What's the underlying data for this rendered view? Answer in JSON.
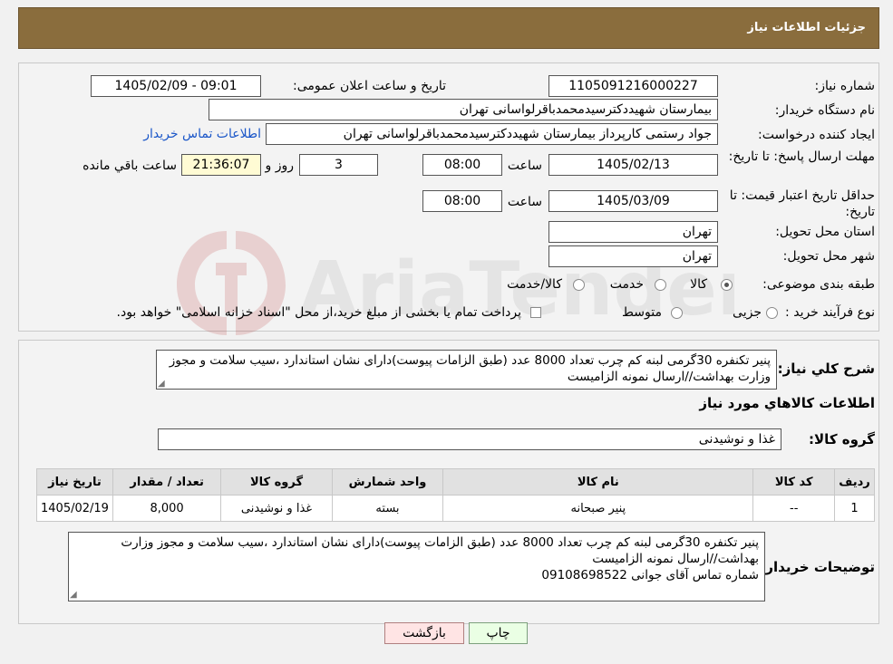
{
  "header": {
    "title": "جزئیات اطلاعات نیاز"
  },
  "form": {
    "need_number": {
      "label": "شماره نیاز:",
      "value": "1105091216000227"
    },
    "announce_datetime": {
      "label": "تاریخ و ساعت اعلان عمومی:",
      "value": "1405/02/09 - 09:01"
    },
    "buyer_org": {
      "label": "نام دستگاه خریدار:",
      "value": "بیمارستان شهیددکترسیدمحمدباقرلواسانی تهران"
    },
    "requester": {
      "label": "ایجاد کننده درخواست:",
      "value": "جواد رستمی کارپرداز بیمارستان شهیددکترسیدمحمدباقرلواسانی تهران",
      "contact_link": "اطلاعات تماس خریدار"
    },
    "deadline": {
      "label": "مهلت ارسال پاسخ: تا تاریخ:",
      "date": "1405/02/13",
      "time_label": "ساعت",
      "time": "08:00",
      "days": "3",
      "days_label": "روز و",
      "remaining": "21:36:07",
      "remaining_label": "ساعت باقي مانده"
    },
    "min_validity": {
      "label": "حداقل تاریخ اعتبار قیمت: تا تاریخ:",
      "date": "1405/03/09",
      "time_label": "ساعت",
      "time": "08:00"
    },
    "delivery_province": {
      "label": "استان محل تحویل:",
      "value": "تهران"
    },
    "delivery_city": {
      "label": "شهر محل تحویل:",
      "value": "تهران"
    },
    "category": {
      "label": "طبقه بندی موضوعی:",
      "options": [
        "کالا",
        "خدمت",
        "کالا/خدمت"
      ],
      "selected": "کالا"
    },
    "purchase_process": {
      "label": "نوع فرآیند خرید :",
      "options": [
        "جزیی",
        "متوسط"
      ],
      "note": "پرداخت تمام یا بخشی از مبلغ خرید،از محل \"اسناد خزانه اسلامی\" خواهد بود."
    }
  },
  "summary": {
    "label": "شرح کلي نياز:",
    "text": "پنیر تکنفره 30گرمی لبنه کم چرب تعداد 8000 عدد (طبق الزامات پیوست)دارای نشان استاندارد ،سیب سلامت و مجوز وزارت بهداشت//ارسال نمونه الزامیست"
  },
  "goods_section": {
    "title": "اطلاعات کالاهاي مورد نياز",
    "group_label": "گروه کالا:",
    "group_value": "غذا و نوشیدنی"
  },
  "items_table": {
    "headers": [
      "رديف",
      "کد کالا",
      "نام کالا",
      "واحد شمارش",
      "گروه کالا",
      "تعداد / مقدار",
      "تاریخ نیاز"
    ],
    "rows": [
      [
        "1",
        "--",
        "پنیر صبحانه",
        "بسته",
        "غذا و نوشیدنی",
        "8,000",
        "1405/02/19"
      ]
    ]
  },
  "buyer_notes": {
    "label": "توضیحات خریدار:",
    "lines": [
      "پنیر تکنفره 30گرمی لبنه کم چرب تعداد 8000 عدد (طبق الزامات پیوست)دارای نشان استاندارد ،سیب سلامت و مجوز وزارت",
      "بهداشت//ارسال نمونه الزامیست",
      "شماره تماس آقای جوانی 09108698522"
    ]
  },
  "buttons": {
    "print": "چاپ",
    "back": "بازگشت"
  },
  "watermark": {
    "text": "AriaTender.neT"
  },
  "colors": {
    "header": "#8a6d3d",
    "link": "#1a56c8",
    "remaining_bg": "#fffbd4",
    "back_bg": "#ffe4e4",
    "print_bg": "#eaffe4"
  }
}
